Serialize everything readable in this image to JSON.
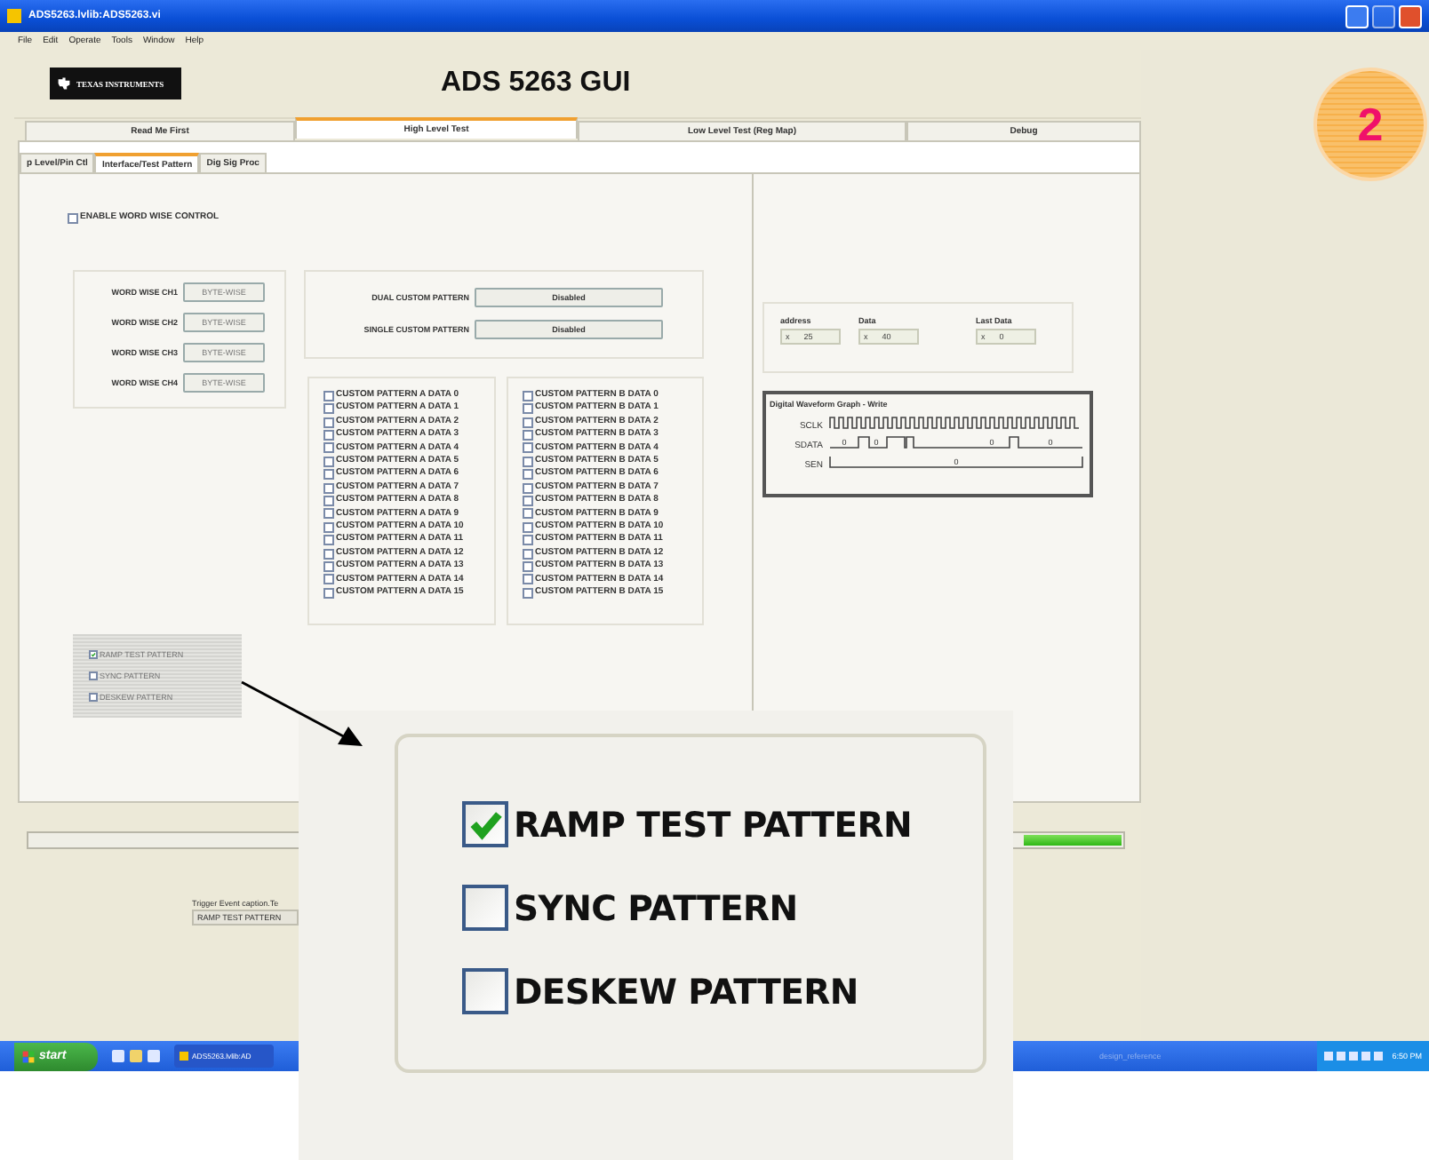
{
  "window": {
    "title": "ADS5263.lvlib:ADS5263.vi"
  },
  "menu": [
    "File",
    "Edit",
    "Operate",
    "Tools",
    "Window",
    "Help"
  ],
  "logo": "TEXAS INSTRUMENTS",
  "heading": "ADS 5263 GUI",
  "tabs": [
    {
      "label": "Read Me First",
      "selected": false
    },
    {
      "label": "High Level Test",
      "selected": true
    },
    {
      "label": "Low Level Test (Reg Map)",
      "selected": false
    },
    {
      "label": "Debug",
      "selected": false
    }
  ],
  "subtabs": [
    {
      "label": "p Level/Pin Ctl",
      "selected": false
    },
    {
      "label": "Interface/Test Pattern",
      "selected": true
    },
    {
      "label": "Dig Sig Proc",
      "selected": false
    }
  ],
  "enable_word_wise": {
    "label": "ENABLE WORD WISE CONTROL",
    "checked": false
  },
  "word_wise": [
    {
      "label": "WORD WISE CH1",
      "value": "BYTE-WISE"
    },
    {
      "label": "WORD WISE CH2",
      "value": "BYTE-WISE"
    },
    {
      "label": "WORD WISE CH3",
      "value": "BYTE-WISE"
    },
    {
      "label": "WORD WISE CH4",
      "value": "BYTE-WISE"
    }
  ],
  "custom_modes": [
    {
      "label": "DUAL CUSTOM PATTERN",
      "value": "Disabled"
    },
    {
      "label": "SINGLE CUSTOM PATTERN",
      "value": "Disabled"
    }
  ],
  "pattern_a": [
    {
      "label": "CUSTOM PATTERN A DATA 0",
      "checked": false
    },
    {
      "label": "CUSTOM PATTERN A DATA 1",
      "checked": false
    },
    {
      "label": "CUSTOM PATTERN A DATA 2",
      "checked": false
    },
    {
      "label": "CUSTOM PATTERN A DATA 3",
      "checked": false
    },
    {
      "label": "CUSTOM PATTERN A DATA 4",
      "checked": false
    },
    {
      "label": "CUSTOM PATTERN A DATA 5",
      "checked": false
    },
    {
      "label": "CUSTOM PATTERN A DATA 6",
      "checked": false
    },
    {
      "label": "CUSTOM PATTERN A DATA 7",
      "checked": false
    },
    {
      "label": "CUSTOM PATTERN A DATA 8",
      "checked": false
    },
    {
      "label": "CUSTOM PATTERN A DATA 9",
      "checked": false
    },
    {
      "label": "CUSTOM PATTERN A DATA 10",
      "checked": false
    },
    {
      "label": "CUSTOM PATTERN A DATA 11",
      "checked": false
    },
    {
      "label": "CUSTOM PATTERN A DATA 12",
      "checked": false
    },
    {
      "label": "CUSTOM PATTERN A DATA 13",
      "checked": false
    },
    {
      "label": "CUSTOM PATTERN A DATA 14",
      "checked": false
    },
    {
      "label": "CUSTOM PATTERN A DATA 15",
      "checked": false
    }
  ],
  "pattern_b": [
    {
      "label": "CUSTOM PATTERN B DATA 0",
      "checked": false
    },
    {
      "label": "CUSTOM PATTERN B DATA 1",
      "checked": false
    },
    {
      "label": "CUSTOM PATTERN B DATA 2",
      "checked": false
    },
    {
      "label": "CUSTOM PATTERN B DATA 3",
      "checked": false
    },
    {
      "label": "CUSTOM PATTERN B DATA 4",
      "checked": false
    },
    {
      "label": "CUSTOM PATTERN B DATA 5",
      "checked": false
    },
    {
      "label": "CUSTOM PATTERN B DATA 6",
      "checked": false
    },
    {
      "label": "CUSTOM PATTERN B DATA 7",
      "checked": false
    },
    {
      "label": "CUSTOM PATTERN B DATA 8",
      "checked": false
    },
    {
      "label": "CUSTOM PATTERN B DATA 9",
      "checked": false
    },
    {
      "label": "CUSTOM PATTERN B DATA 10",
      "checked": false
    },
    {
      "label": "CUSTOM PATTERN B DATA 11",
      "checked": false
    },
    {
      "label": "CUSTOM PATTERN B DATA 12",
      "checked": false
    },
    {
      "label": "CUSTOM PATTERN B DATA 13",
      "checked": false
    },
    {
      "label": "CUSTOM PATTERN B DATA 14",
      "checked": false
    },
    {
      "label": "CUSTOM PATTERN B DATA 15",
      "checked": false
    }
  ],
  "test_patterns": [
    {
      "label": "RAMP TEST PATTERN",
      "checked": true
    },
    {
      "label": "SYNC PATTERN",
      "checked": false
    },
    {
      "label": "DESKEW PATTERN",
      "checked": false
    }
  ],
  "registers": [
    {
      "label": "address",
      "radix": "x",
      "value": "25"
    },
    {
      "label": "Data",
      "radix": "x",
      "value": "40"
    },
    {
      "label": "Last Data",
      "radix": "x",
      "value": "0"
    }
  ],
  "waveform": {
    "title": "Digital Waveform Graph - Write",
    "signals": [
      {
        "name": "SCLK",
        "kind": "clock"
      },
      {
        "name": "SDATA",
        "kind": "data",
        "values": [
          "0",
          "0",
          "0",
          "0"
        ]
      },
      {
        "name": "SEN",
        "kind": "level",
        "values": [
          "0"
        ]
      }
    ]
  },
  "activity": {
    "level": 0.09
  },
  "trigger": {
    "label": "Trigger Event caption.Te",
    "value": "RAMP TEST PATTERN"
  },
  "taskbar": {
    "start": "start",
    "task": "ADS5263.lvlib:AD",
    "hint": "design_reference",
    "clock": "6:50 PM"
  },
  "badge": "2",
  "callout": [
    {
      "label": "RAMP TEST PATTERN",
      "checked": true
    },
    {
      "label": "SYNC PATTERN",
      "checked": false
    },
    {
      "label": "DESKEW PATTERN",
      "checked": false
    }
  ]
}
